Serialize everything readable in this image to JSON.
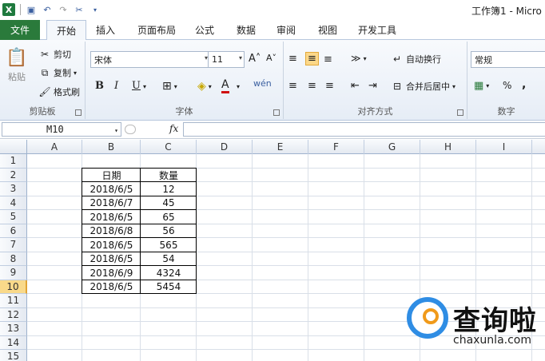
{
  "window": {
    "title": "工作簿1 - Micro"
  },
  "tabs": {
    "file": "文件",
    "items": [
      "开始",
      "插入",
      "页面布局",
      "公式",
      "数据",
      "审阅",
      "视图",
      "开发工具"
    ],
    "active": "开始"
  },
  "ribbon": {
    "clipboard": {
      "label": "剪贴板",
      "paste": "粘贴",
      "cut": "剪切",
      "copy": "复制",
      "format_painter": "格式刷"
    },
    "font": {
      "label": "字体",
      "family": "宋体",
      "size": "11",
      "bold": "B",
      "italic": "I",
      "underline": "U"
    },
    "alignment": {
      "label": "对齐方式",
      "wrap": "自动换行",
      "merge": "合并后居中"
    },
    "number": {
      "label": "数字",
      "format": "常规",
      "percent": "%",
      "comma": ","
    }
  },
  "formula_bar": {
    "name_box": "M10",
    "fx": "fx",
    "value": ""
  },
  "grid": {
    "columns": [
      "A",
      "B",
      "C",
      "D",
      "E",
      "F",
      "G",
      "H",
      "I"
    ],
    "rows": [
      "1",
      "2",
      "3",
      "4",
      "5",
      "6",
      "7",
      "8",
      "9",
      "10",
      "11",
      "12",
      "13",
      "14",
      "15"
    ],
    "selected_row": "10",
    "table": {
      "headers": [
        "日期",
        "数量"
      ],
      "rows": [
        [
          "2018/6/5",
          "12"
        ],
        [
          "2018/6/7",
          "45"
        ],
        [
          "2018/6/5",
          "65"
        ],
        [
          "2018/6/8",
          "56"
        ],
        [
          "2018/6/5",
          "565"
        ],
        [
          "2018/6/5",
          "54"
        ],
        [
          "2018/6/9",
          "4324"
        ],
        [
          "2018/6/5",
          "5454"
        ]
      ]
    }
  },
  "watermark": {
    "cn": "查询啦",
    "en": "chaxunla.com"
  }
}
